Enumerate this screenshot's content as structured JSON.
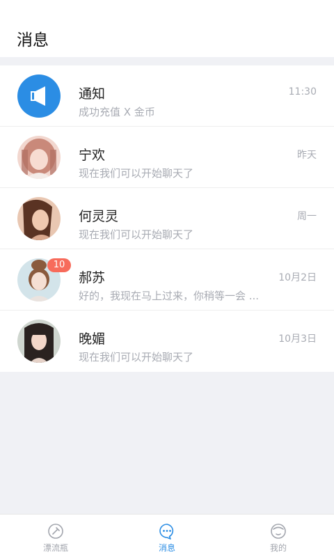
{
  "header": {
    "title": "消息"
  },
  "messages": [
    {
      "name": "通知",
      "preview": "成功充值 X 金币",
      "time": "11:30",
      "avatar": "notification-speaker",
      "badge": ""
    },
    {
      "name": "宁欢",
      "preview": "现在我们可以开始聊天了",
      "time": "昨天",
      "avatar": "user-photo",
      "badge": ""
    },
    {
      "name": "何灵灵",
      "preview": "现在我们可以开始聊天了",
      "time": "周一",
      "avatar": "user-photo",
      "badge": ""
    },
    {
      "name": "郝苏",
      "preview": "好的，我现在马上过来，你稍等一会 ...",
      "time": "10月2日",
      "avatar": "user-photo",
      "badge": "10"
    },
    {
      "name": "晚媚",
      "preview": "现在我们可以开始聊天了",
      "time": "10月3日",
      "avatar": "user-photo",
      "badge": ""
    }
  ],
  "tabbar": {
    "tabs": [
      {
        "label": "漂流瓶",
        "icon": "bottle-icon",
        "active": false
      },
      {
        "label": "消息",
        "icon": "chat-bubble-icon",
        "active": true
      },
      {
        "label": "我的",
        "icon": "profile-icon",
        "active": false
      }
    ]
  },
  "colors": {
    "accent": "#2b8de4",
    "badge": "#f76b5b",
    "muted": "#a8abb3"
  }
}
